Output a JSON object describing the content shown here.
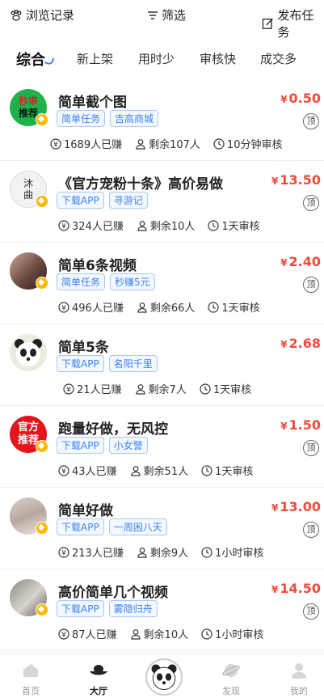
{
  "topbar": {
    "browse_label": "浏览记录",
    "filter_label": "筛选",
    "publish_label": "发布任务"
  },
  "tabs": [
    "综合",
    "新上架",
    "用时少",
    "审核快",
    "成交多"
  ],
  "currency": "¥",
  "top_label": "顶",
  "tasks": [
    {
      "title": "简单截个图",
      "tags": [
        "简单任务",
        "吉高商城"
      ],
      "price": "0.50",
      "earned": "1689人已赚",
      "remaining": "剩余107人",
      "review": "10分钟审核",
      "thumb_text": [
        "秒审",
        "推荐"
      ]
    },
    {
      "title": "《官方宠粉十条》高价易做",
      "tags": [
        "下载APP",
        "寻游记"
      ],
      "price": "13.50",
      "earned": "324人已赚",
      "remaining": "剩余10人",
      "review": "1天审核",
      "thumb_text": [
        "沐",
        "曲"
      ]
    },
    {
      "title": "简单6条视频",
      "tags": [
        "简单任务",
        "秒赚5元"
      ],
      "price": "2.40",
      "earned": "496人已赚",
      "remaining": "剩余66人",
      "review": "1天审核"
    },
    {
      "title": "简单5条",
      "tags": [
        "下载APP",
        "名阳千里"
      ],
      "price": "2.68",
      "earned": "21人已赚",
      "remaining": "剩余7人",
      "review": "1天审核"
    },
    {
      "title": "跑量好做，无风控",
      "tags": [
        "下载APP",
        "小女警"
      ],
      "price": "1.50",
      "earned": "43人已赚",
      "remaining": "剩余51人",
      "review": "1天审核",
      "thumb_text": [
        "官方",
        "推荐"
      ]
    },
    {
      "title": "简单好做",
      "tags": [
        "下载APP",
        "一周困八天"
      ],
      "price": "13.00",
      "earned": "213人已赚",
      "remaining": "剩余9人",
      "review": "1小时审核"
    },
    {
      "title": "高价简单几个视频",
      "tags": [
        "下载APP",
        "雾隐归舟"
      ],
      "price": "14.50",
      "earned": "87人已赚",
      "remaining": "剩余10人",
      "review": "1小时审核"
    }
  ],
  "bottom_nav": {
    "home": "首页",
    "hall": "大厅",
    "discover": "发现",
    "mine": "我的"
  },
  "colors": {
    "accent": "#3b82f6",
    "price": "#f04b3a",
    "badge": "#ffb800"
  }
}
